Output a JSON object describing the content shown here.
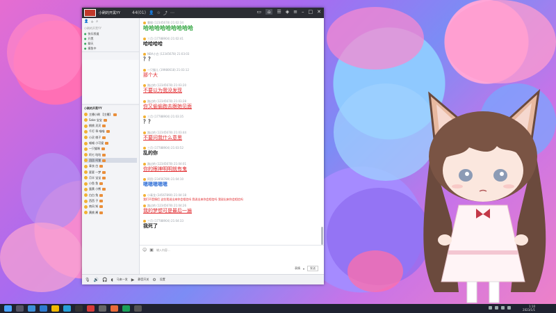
{
  "window": {
    "title": "小刷的开黑YY",
    "room_id": "44(01)",
    "tabs": [
      "home",
      "chat",
      "settings"
    ]
  },
  "left_panel": {
    "channel_items": [
      {
        "icon": "●",
        "label": "快乐频道"
      },
      {
        "icon": "●",
        "label": "开黑"
      },
      {
        "icon": "●",
        "label": "聊天"
      },
      {
        "icon": "●",
        "label": "摸鱼中"
      }
    ],
    "members_header": "小刷的开黑YY",
    "members": [
      "主播小刷 【主播】",
      "Sake 宝宝",
      "桃桃 灵灵",
      "千灯 乖 喵喵",
      "小灵 桃子",
      "喵喵 小可爱",
      "一只猫咪",
      "阿七 咕咕",
      "团团 阿狸",
      "青衣 白",
      "夏夏 一梦",
      "月半 宝宝",
      "小鱼 鱼",
      "蛋黄 小熊",
      "白白 兔",
      "西西 子",
      "南风 知",
      "黄桃 酱"
    ],
    "selected_member_index": 8
  },
  "chat": {
    "messages": [
      {
        "meta": "曹操 (12345678) 21:02:34",
        "text": "哈哈哈哈哈哈哈哈哈",
        "style": "green"
      },
      {
        "meta": "三月 (17788904) 21:02:41",
        "text": "哈哈哈哈",
        "style": "dark"
      },
      {
        "meta": "NBA小白 (12345678) 21:03:03",
        "text": "？？",
        "style": "dark"
      },
      {
        "meta": "一只猫儿 (19980618) 21:03:12",
        "text": "那个大",
        "style": "red"
      },
      {
        "meta": "路过的 (12345678) 21:03:20",
        "text": "不要以为我没发现",
        "style": "redser"
      },
      {
        "meta": "路过的 (12345678) 21:03:28",
        "text": "你又偷偷跑去跟她见面",
        "style": "redser"
      },
      {
        "meta": "三月 (17788904) 21:03:35",
        "text": "？？",
        "style": "dark"
      },
      {
        "meta": "路过的 (12345678) 21:03:44",
        "text": "不要问我什么意思",
        "style": "redser"
      },
      {
        "meta": "三月 (17788904) 21:03:52",
        "text": "乱的你",
        "style": "dark"
      },
      {
        "meta": "路过的 (12345678) 21:04:01",
        "text": "你的眼神明明就有鬼",
        "style": "redser"
      },
      {
        "meta": "阿团 (23456789) 21:04:10",
        "text": "嗯嗯嗯嗯嗯",
        "style": "blue"
      },
      {
        "meta": "小青龙 (34567890) 21:04:18",
        "text": "我们不是情侣 这些我说出来你会相信吗 我说出来你会相信吗 我说出来你会相信吗",
        "style": "smallred"
      },
      {
        "meta": "路过的 (12345678) 21:04:26",
        "text": "我的梦想可是最后一遍",
        "style": "redser"
      },
      {
        "meta": "三月 (17788904) 21:04:33",
        "text": "我死了",
        "style": "dark"
      }
    ]
  },
  "input": {
    "placeholder": "输入内容...",
    "send_label": "发送",
    "emoji_label": "表情"
  },
  "bottom_bar": {
    "items": [
      "马来一发",
      "静音开关",
      "设置"
    ]
  },
  "taskbar": {
    "time": "1:10",
    "date": "2023/1/1"
  }
}
